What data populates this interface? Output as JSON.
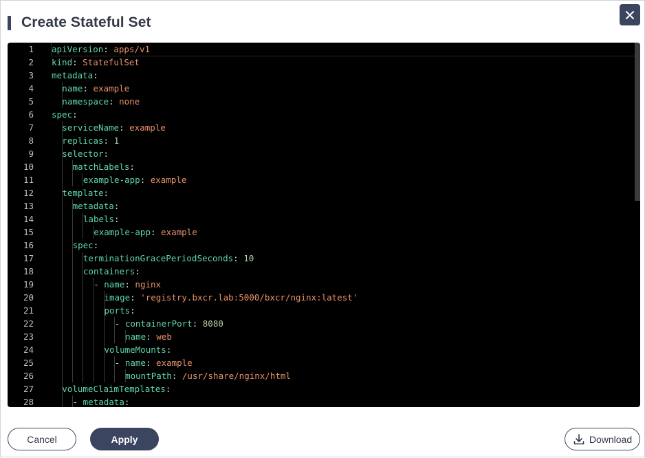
{
  "dialog": {
    "title": "Create Stateful Set",
    "close_icon": "close-icon"
  },
  "colors": {
    "accent": "#3c4560",
    "editor_bg": "#000000",
    "key": "#5fd7a7",
    "string_value": "#e8916a",
    "number_value": "#b5cea8",
    "punctuation": "#e0e0e0"
  },
  "editor": {
    "lines": [
      {
        "num": "1",
        "indent": 0,
        "parts": [
          {
            "t": "apiVersion",
            "c": "k"
          },
          {
            "t": ": ",
            "c": "p"
          },
          {
            "t": "apps/v1",
            "c": "v"
          }
        ]
      },
      {
        "num": "2",
        "indent": 0,
        "parts": [
          {
            "t": "kind",
            "c": "k"
          },
          {
            "t": ": ",
            "c": "p"
          },
          {
            "t": "StatefulSet",
            "c": "v"
          }
        ]
      },
      {
        "num": "3",
        "indent": 0,
        "parts": [
          {
            "t": "metadata",
            "c": "k"
          },
          {
            "t": ":",
            "c": "p"
          }
        ]
      },
      {
        "num": "4",
        "indent": 1,
        "parts": [
          {
            "t": "name",
            "c": "k"
          },
          {
            "t": ": ",
            "c": "p"
          },
          {
            "t": "example",
            "c": "v"
          }
        ]
      },
      {
        "num": "5",
        "indent": 1,
        "parts": [
          {
            "t": "namespace",
            "c": "k"
          },
          {
            "t": ": ",
            "c": "p"
          },
          {
            "t": "none",
            "c": "v"
          }
        ]
      },
      {
        "num": "6",
        "indent": 0,
        "parts": [
          {
            "t": "spec",
            "c": "k"
          },
          {
            "t": ":",
            "c": "p"
          }
        ]
      },
      {
        "num": "7",
        "indent": 1,
        "parts": [
          {
            "t": "serviceName",
            "c": "k"
          },
          {
            "t": ": ",
            "c": "p"
          },
          {
            "t": "example",
            "c": "v"
          }
        ]
      },
      {
        "num": "8",
        "indent": 1,
        "parts": [
          {
            "t": "replicas",
            "c": "k"
          },
          {
            "t": ": ",
            "c": "p"
          },
          {
            "t": "1",
            "c": "n"
          }
        ]
      },
      {
        "num": "9",
        "indent": 1,
        "parts": [
          {
            "t": "selector",
            "c": "k"
          },
          {
            "t": ":",
            "c": "p"
          }
        ]
      },
      {
        "num": "10",
        "indent": 2,
        "parts": [
          {
            "t": "matchLabels",
            "c": "k"
          },
          {
            "t": ":",
            "c": "p"
          }
        ]
      },
      {
        "num": "11",
        "indent": 3,
        "parts": [
          {
            "t": "example-app",
            "c": "k"
          },
          {
            "t": ": ",
            "c": "p"
          },
          {
            "t": "example",
            "c": "v"
          }
        ]
      },
      {
        "num": "12",
        "indent": 1,
        "parts": [
          {
            "t": "template",
            "c": "k"
          },
          {
            "t": ":",
            "c": "p"
          }
        ]
      },
      {
        "num": "13",
        "indent": 2,
        "parts": [
          {
            "t": "metadata",
            "c": "k"
          },
          {
            "t": ":",
            "c": "p"
          }
        ]
      },
      {
        "num": "14",
        "indent": 3,
        "parts": [
          {
            "t": "labels",
            "c": "k"
          },
          {
            "t": ":",
            "c": "p"
          }
        ]
      },
      {
        "num": "15",
        "indent": 4,
        "parts": [
          {
            "t": "example-app",
            "c": "k"
          },
          {
            "t": ": ",
            "c": "p"
          },
          {
            "t": "example",
            "c": "v"
          }
        ]
      },
      {
        "num": "16",
        "indent": 2,
        "parts": [
          {
            "t": "spec",
            "c": "k"
          },
          {
            "t": ":",
            "c": "p"
          }
        ]
      },
      {
        "num": "17",
        "indent": 3,
        "parts": [
          {
            "t": "terminationGracePeriodSeconds",
            "c": "k"
          },
          {
            "t": ": ",
            "c": "p"
          },
          {
            "t": "10",
            "c": "n"
          }
        ]
      },
      {
        "num": "18",
        "indent": 3,
        "parts": [
          {
            "t": "containers",
            "c": "k"
          },
          {
            "t": ":",
            "c": "p"
          }
        ]
      },
      {
        "num": "19",
        "indent": 4,
        "parts": [
          {
            "t": "- ",
            "c": "p"
          },
          {
            "t": "name",
            "c": "k"
          },
          {
            "t": ": ",
            "c": "p"
          },
          {
            "t": "nginx",
            "c": "v"
          }
        ]
      },
      {
        "num": "20",
        "indent": 5,
        "parts": [
          {
            "t": "image",
            "c": "k"
          },
          {
            "t": ": ",
            "c": "p"
          },
          {
            "t": "'registry.bxcr.lab:5000/bxcr/nginx:latest'",
            "c": "v"
          }
        ]
      },
      {
        "num": "21",
        "indent": 5,
        "parts": [
          {
            "t": "ports",
            "c": "k"
          },
          {
            "t": ":",
            "c": "p"
          }
        ]
      },
      {
        "num": "22",
        "indent": 6,
        "parts": [
          {
            "t": "- ",
            "c": "p"
          },
          {
            "t": "containerPort",
            "c": "k"
          },
          {
            "t": ": ",
            "c": "p"
          },
          {
            "t": "8080",
            "c": "n"
          }
        ]
      },
      {
        "num": "23",
        "indent": 7,
        "parts": [
          {
            "t": "name",
            "c": "k"
          },
          {
            "t": ": ",
            "c": "p"
          },
          {
            "t": "web",
            "c": "v"
          }
        ]
      },
      {
        "num": "24",
        "indent": 5,
        "parts": [
          {
            "t": "volumeMounts",
            "c": "k"
          },
          {
            "t": ":",
            "c": "p"
          }
        ]
      },
      {
        "num": "25",
        "indent": 6,
        "parts": [
          {
            "t": "- ",
            "c": "p"
          },
          {
            "t": "name",
            "c": "k"
          },
          {
            "t": ": ",
            "c": "p"
          },
          {
            "t": "example",
            "c": "v"
          }
        ]
      },
      {
        "num": "26",
        "indent": 7,
        "parts": [
          {
            "t": "mountPath",
            "c": "k"
          },
          {
            "t": ": ",
            "c": "p"
          },
          {
            "t": "/usr/share/nginx/html",
            "c": "v"
          }
        ]
      },
      {
        "num": "27",
        "indent": 1,
        "parts": [
          {
            "t": "volumeClaimTemplates",
            "c": "k"
          },
          {
            "t": ":",
            "c": "p"
          }
        ]
      },
      {
        "num": "28",
        "indent": 2,
        "parts": [
          {
            "t": "- ",
            "c": "p"
          },
          {
            "t": "metadata",
            "c": "k"
          },
          {
            "t": ":",
            "c": "p"
          }
        ]
      }
    ]
  },
  "footer": {
    "cancel_label": "Cancel",
    "apply_label": "Apply",
    "download_label": "Download",
    "download_icon": "download-icon"
  }
}
